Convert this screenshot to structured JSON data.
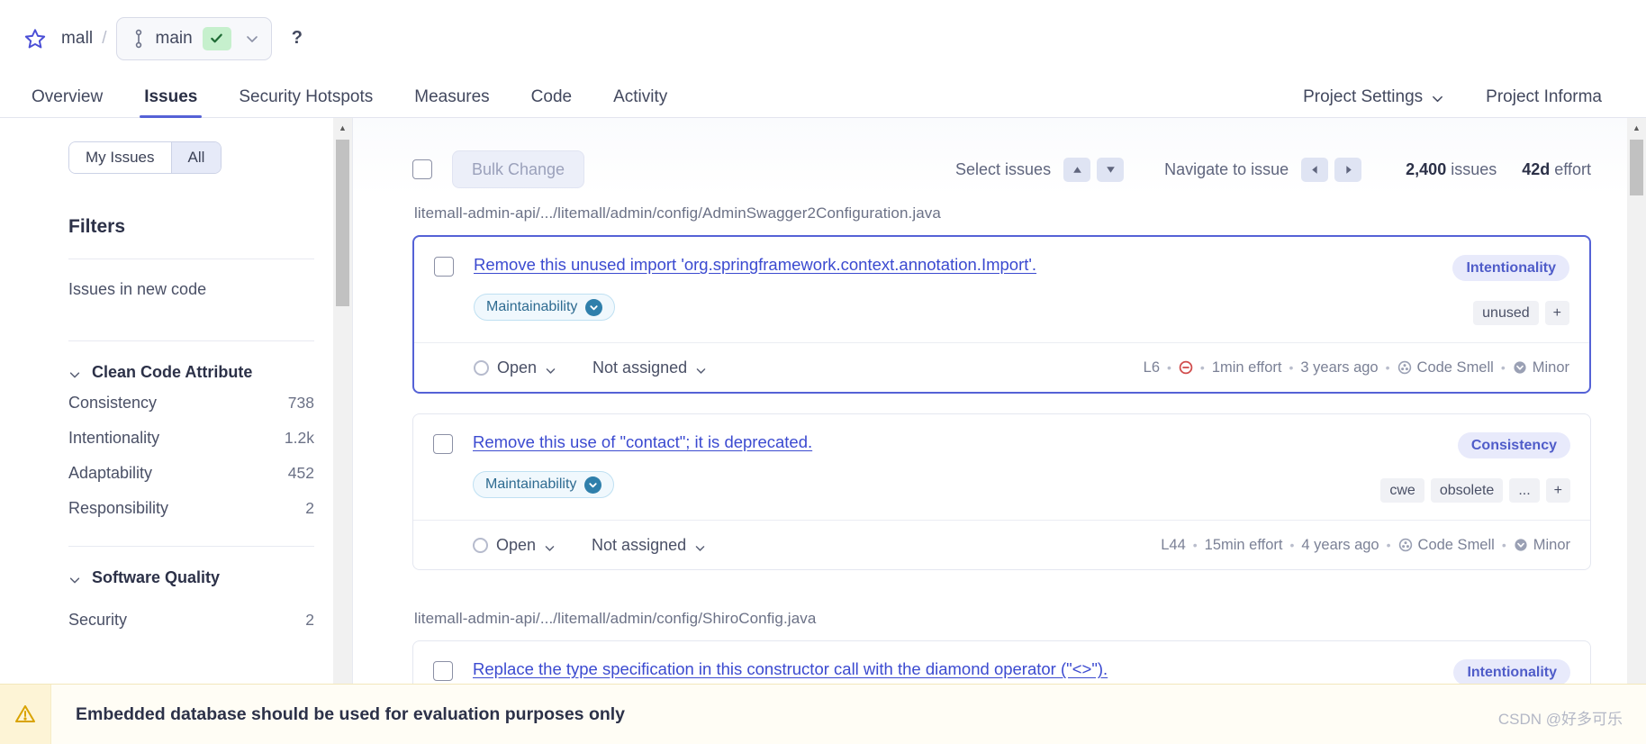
{
  "breadcrumb": {
    "star_icon": "star-icon",
    "project": "mall",
    "separator": "/",
    "branch_icon": "branch-icon",
    "branch": "main",
    "branch_status_icon": "check-icon",
    "branch_chevron": "chevron-down-icon",
    "help": "?"
  },
  "nav": {
    "items": [
      {
        "label": "Overview",
        "active": false
      },
      {
        "label": "Issues",
        "active": true
      },
      {
        "label": "Security Hotspots",
        "active": false
      },
      {
        "label": "Measures",
        "active": false
      },
      {
        "label": "Code",
        "active": false
      },
      {
        "label": "Activity",
        "active": false
      }
    ],
    "right": [
      {
        "label": "Project Settings",
        "chevron": true
      },
      {
        "label": "Project Informa",
        "chevron": false
      }
    ]
  },
  "sidebar": {
    "segments": [
      {
        "label": "My Issues",
        "active": false
      },
      {
        "label": "All",
        "active": true
      }
    ],
    "filters_title": "Filters",
    "new_code_row": "Issues in new code",
    "groups": [
      {
        "title": "Clean Code Attribute",
        "chevron": "chevron-down-icon",
        "items": [
          {
            "label": "Consistency",
            "count": "738"
          },
          {
            "label": "Intentionality",
            "count": "1.2k"
          },
          {
            "label": "Adaptability",
            "count": "452"
          },
          {
            "label": "Responsibility",
            "count": "2"
          }
        ]
      },
      {
        "title": "Software Quality",
        "chevron": "chevron-down-icon",
        "items": [
          {
            "label": "Security",
            "count": "2"
          }
        ]
      }
    ]
  },
  "toolbar": {
    "select_all_checkbox": "",
    "bulk_change": "Bulk Change",
    "select_issues_label": "Select issues",
    "select_up_icon": "caret-up-icon",
    "select_down_icon": "caret-down-icon",
    "navigate_label": "Navigate to issue",
    "nav_prev_icon": "caret-left-icon",
    "nav_next_icon": "caret-right-icon",
    "issues_count": "2,400",
    "issues_word": "issues",
    "effort_value": "42d",
    "effort_word": "effort"
  },
  "groups": [
    {
      "file_path": "litemall-admin-api/.../litemall/admin/config/AdminSwagger2Configuration.java",
      "issues": [
        {
          "selected": true,
          "title": "Remove this unused import 'org.springframework.context.annotation.Import'.",
          "quality": "Maintainability",
          "attribute": "Intentionality",
          "tags": [
            "unused"
          ],
          "tag_add": "+",
          "status": "Open",
          "assignee": "Not assigned",
          "line": "L6",
          "effort": "1min effort",
          "age": "3 years ago",
          "type": "Code Smell",
          "severity": "Minor"
        },
        {
          "selected": false,
          "title": "Remove this use of \"contact\"; it is deprecated.",
          "quality": "Maintainability",
          "attribute": "Consistency",
          "tags": [
            "cwe",
            "obsolete",
            "..."
          ],
          "tag_add": "+",
          "status": "Open",
          "assignee": "Not assigned",
          "line": "L44",
          "effort": "15min effort",
          "age": "4 years ago",
          "type": "Code Smell",
          "severity": "Minor"
        }
      ]
    },
    {
      "file_path": "litemall-admin-api/.../litemall/admin/config/ShiroConfig.java",
      "issues": [
        {
          "selected": false,
          "title": "Replace the type specification in this constructor call with the diamond operator (\"<>\").",
          "quality": "",
          "attribute": "Intentionality",
          "tags": [],
          "tag_add": "",
          "status": "",
          "assignee": "",
          "line": "",
          "effort": "",
          "age": "",
          "type": "",
          "severity": ""
        }
      ]
    }
  ],
  "banner": {
    "icon": "warning-icon",
    "text": "Embedded database should be used for evaluation purposes only"
  },
  "watermark": "CSDN @好多可乐",
  "colors": {
    "accent": "#5562d6",
    "link": "#3b4ad0",
    "attribute_pill_bg": "#e8eafb",
    "quality_pill_border": "#bfe0f2",
    "banner_bg": "#fffdf5"
  }
}
